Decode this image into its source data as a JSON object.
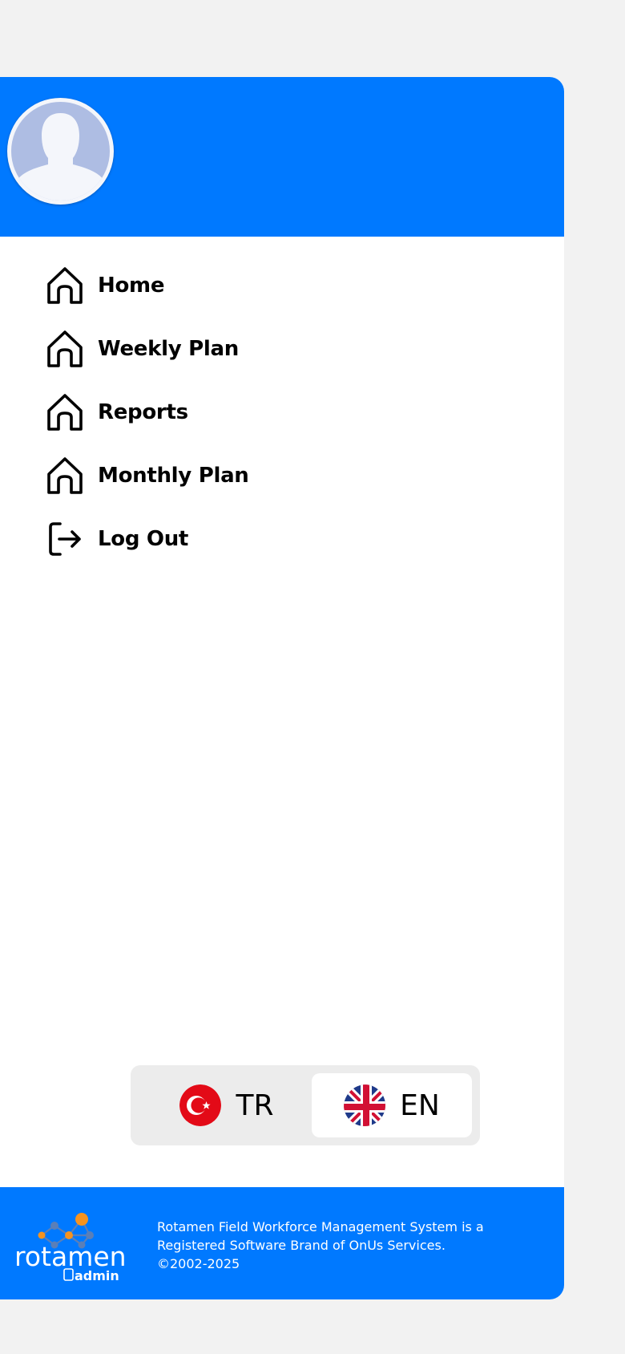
{
  "menu": {
    "items": [
      {
        "label": "Home",
        "icon": "home-icon"
      },
      {
        "label": "Weekly Plan",
        "icon": "home-icon"
      },
      {
        "label": "Reports",
        "icon": "home-icon"
      },
      {
        "label": "Monthly Plan",
        "icon": "home-icon"
      },
      {
        "label": "Log Out",
        "icon": "logout-icon"
      }
    ]
  },
  "language": {
    "options": [
      {
        "code": "TR",
        "icon": "turkey-flag-icon"
      },
      {
        "code": "EN",
        "icon": "uk-flag-icon"
      }
    ],
    "selected": "EN"
  },
  "footer": {
    "logo_text": "rotamen",
    "logo_subtext": "admin",
    "line1": "Rotamen Field Workforce Management System is a",
    "line2": "Registered Software Brand of OnUs Services.",
    "line3": "©2002-2025"
  },
  "colors": {
    "accent": "#0079ff",
    "background": "#f2f2f2",
    "avatar": "#aebde3"
  }
}
